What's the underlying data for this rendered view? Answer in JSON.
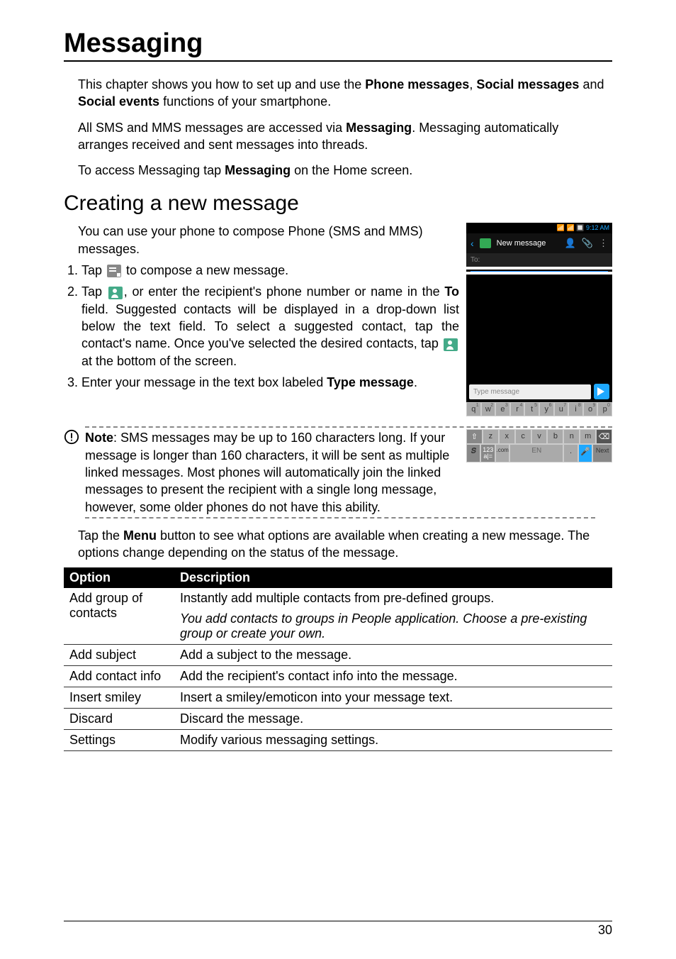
{
  "chapter_title": "Messaging",
  "intro": {
    "p1_pre": "This chapter shows you how to set up and use the ",
    "b1": "Phone messages",
    "p1_mid1": ", ",
    "b2": "Social messages",
    "p1_mid2": " and ",
    "b3": "Social events",
    "p1_post": " functions of your smartphone.",
    "p2_pre": "All SMS and MMS messages are accessed via ",
    "b4": "Messaging",
    "p2_post": ". Messaging automatically arranges received and sent messages into threads.",
    "p3_pre": "To access Messaging tap ",
    "b5": "Messaging",
    "p3_post": " on the Home screen."
  },
  "section_title": "Creating a new message",
  "lead_in": "You can use your phone to compose Phone (SMS and MMS) messages.",
  "steps": {
    "s1_pre": "Tap ",
    "s1_post": " to compose a new message.",
    "s2_pre": "Tap ",
    "s2_mid1": ", or enter the recipient's phone number or name in the ",
    "s2_b1": "To",
    "s2_mid2": " field. Suggested contacts will be displayed in a drop-down list below the text field. To select a suggested contact, tap the contact's name. Once you've selected the desired contacts, tap ",
    "s2_post": " at the bottom of the screen.",
    "s3_pre": "Enter your message in the text box labeled ",
    "s3_b1": "Type message",
    "s3_post": "."
  },
  "note": {
    "bold": "Note",
    "text": ": SMS messages may be up to 160 characters long. If your message is longer than 160 characters, it will be sent as multiple linked messages. Most phones will automatically join the linked messages to present the recipient with a single long message, however, some older phones do not have this ability."
  },
  "after_note_pre": "Tap the ",
  "after_note_b": "Menu",
  "after_note_post": " button to see what options are available when creating a new message. The options change depending on the status of the message.",
  "table": {
    "headers": {
      "option": "Option",
      "desc": "Description"
    },
    "rows": [
      {
        "option": "Add group of contacts",
        "desc": "Instantly add multiple contacts from pre-defined groups.",
        "sub_desc": "You add contacts to groups in People application. Choose a pre-existing group or create your own."
      },
      {
        "option": "Add subject",
        "desc": "Add a subject to the message."
      },
      {
        "option": "Add contact info",
        "desc": "Add the recipient's contact info into the message."
      },
      {
        "option": "Insert smiley",
        "desc": "Insert a smiley/emoticon into your message text."
      },
      {
        "option": "Discard",
        "desc": "Discard the message."
      },
      {
        "option": "Settings",
        "desc": "Modify various messaging settings."
      }
    ]
  },
  "page_number": "30",
  "phone": {
    "time": "9:12 AM",
    "header_title": "New message",
    "to_label": "To:",
    "type_placeholder": "Type message",
    "row1": [
      "q",
      "w",
      "e",
      "r",
      "t",
      "y",
      "u",
      "i",
      "o",
      "p"
    ],
    "nums1": [
      "1",
      "2",
      "3",
      "4",
      "5",
      "6",
      "7",
      "8",
      "9",
      "0"
    ],
    "row2": [
      "z",
      "x",
      "c",
      "v",
      "b",
      "n",
      "m"
    ],
    "shift": "⇧",
    "del": "⌫",
    "fn": "123\na|=",
    "com": ".com",
    "space": "EN",
    "mic": "🎤",
    "next": "Next"
  }
}
